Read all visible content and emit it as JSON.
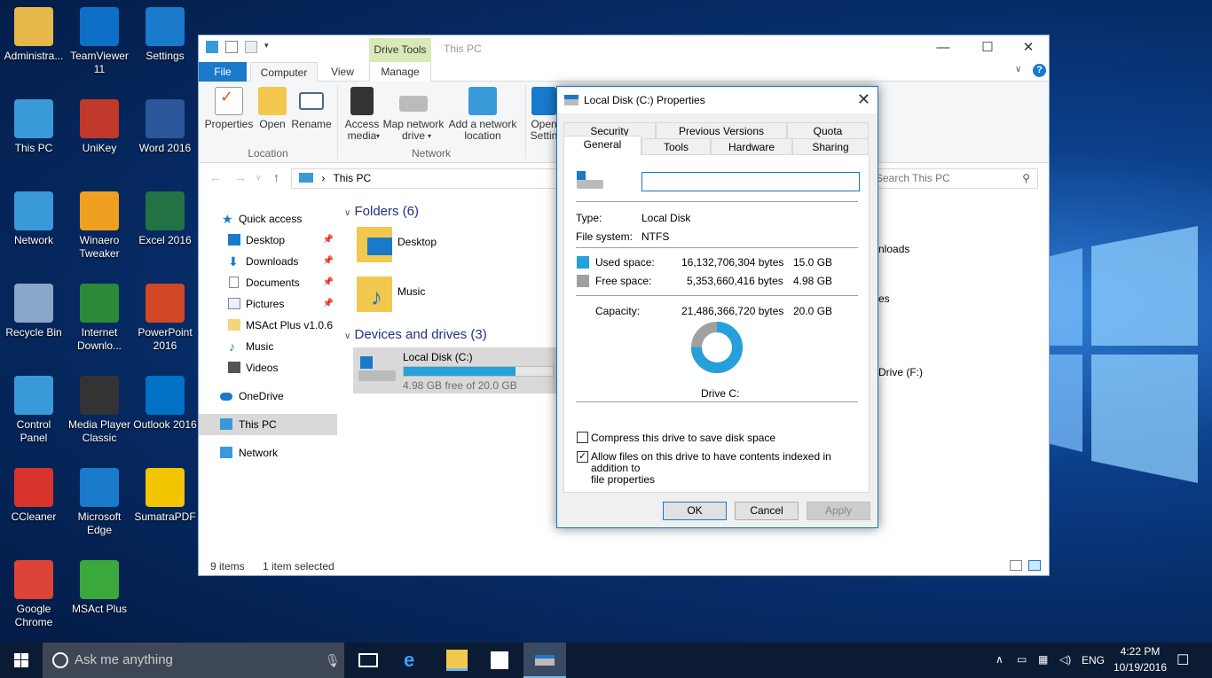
{
  "desktop": {
    "icons": [
      {
        "label": "Administra...",
        "icon": "user-folder-icon",
        "color": "#e6b84a"
      },
      {
        "label": "TeamViewer\n11",
        "icon": "teamviewer-icon",
        "color": "#0e6fc7"
      },
      {
        "label": "Settings",
        "icon": "gear-icon",
        "color": "#1979ca"
      },
      {
        "label": "This PC",
        "icon": "computer-icon",
        "color": "#3a9ad9"
      },
      {
        "label": "UniKey",
        "icon": "unikey-icon",
        "color": "#c0392b"
      },
      {
        "label": "Word 2016",
        "icon": "word-icon",
        "color": "#2b579a"
      },
      {
        "label": "Network",
        "icon": "network-icon",
        "color": "#3a9ad9"
      },
      {
        "label": "Winaero\nTweaker",
        "icon": "winaero-icon",
        "color": "#f0a020"
      },
      {
        "label": "Excel 2016",
        "icon": "excel-icon",
        "color": "#217346"
      },
      {
        "label": "Recycle Bin",
        "icon": "recycle-bin-icon",
        "color": "#8aa6c8"
      },
      {
        "label": "Internet\nDownlo...",
        "icon": "idm-icon",
        "color": "#2a8a3a"
      },
      {
        "label": "PowerPoint\n2016",
        "icon": "powerpoint-icon",
        "color": "#d24726"
      },
      {
        "label": "Control\nPanel",
        "icon": "control-panel-icon",
        "color": "#3a9ad9"
      },
      {
        "label": "Media Player\nClassic",
        "icon": "media-player-icon",
        "color": "#333"
      },
      {
        "label": "Outlook 2016",
        "icon": "outlook-icon",
        "color": "#0072c6"
      },
      {
        "label": "CCleaner",
        "icon": "ccleaner-icon",
        "color": "#d9342b"
      },
      {
        "label": "Microsoft\nEdge",
        "icon": "edge-icon",
        "color": "#1979ca"
      },
      {
        "label": "SumatraPDF",
        "icon": "pdf-icon",
        "color": "#f2c500"
      },
      {
        "label": "Google\nChrome",
        "icon": "chrome-icon",
        "color": "#db4437"
      },
      {
        "label": "MSAct Plus",
        "icon": "key-icon",
        "color": "#3aa83a"
      }
    ]
  },
  "explorer": {
    "drive_tools": "Drive Tools",
    "title": "This PC",
    "tabs": {
      "file": "File",
      "computer": "Computer",
      "view": "View",
      "manage": "Manage"
    },
    "ribbon": {
      "properties": "Properties",
      "open": "Open",
      "rename": "Rename",
      "access_media": "Access\nmedia",
      "map_network": "Map network\ndrive",
      "add_network": "Add a network\nlocation",
      "open_settings": "Open\nSettin",
      "group_location": "Location",
      "group_network": "Network"
    },
    "address": "This PC",
    "search_placeholder": "Search This PC",
    "sidebar": {
      "quick_access": "Quick access",
      "desktop": "Desktop",
      "downloads": "Downloads",
      "documents": "Documents",
      "pictures": "Pictures",
      "msact": "MSAct Plus v1.0.6",
      "music": "Music",
      "videos": "Videos",
      "onedrive": "OneDrive",
      "thispc": "This PC",
      "network": "Network"
    },
    "folders_header": "Folders (6)",
    "folders": {
      "desktop": "Desktop",
      "music": "Music",
      "downloads_partial": "nloads",
      "pictures_partial": "es"
    },
    "devices_header": "Devices and drives (3)",
    "drive_c": {
      "name": "Local Disk (C:)",
      "free": "4.98 GB free of 20.0 GB",
      "used_fraction": 0.75
    },
    "drive_f_partial": "Drive (F:)",
    "status": {
      "items": "9 items",
      "selected": "1 item selected"
    }
  },
  "dialog": {
    "title": "Local Disk (C:) Properties",
    "tabs_top": {
      "security": "Security",
      "previous": "Previous Versions",
      "quota": "Quota"
    },
    "tabs_bottom": {
      "general": "General",
      "tools": "Tools",
      "hardware": "Hardware",
      "sharing": "Sharing"
    },
    "name_value": "",
    "type_label": "Type:",
    "type_value": "Local Disk",
    "fs_label": "File system:",
    "fs_value": "NTFS",
    "used_label": "Used space:",
    "used_bytes": "16,132,706,304 bytes",
    "used_gb": "15.0 GB",
    "free_label": "Free space:",
    "free_bytes": "5,353,660,416 bytes",
    "free_gb": "4.98 GB",
    "capacity_label": "Capacity:",
    "capacity_bytes": "21,486,366,720 bytes",
    "capacity_gb": "20.0 GB",
    "used_color": "#26a0da",
    "free_color": "#a0a0a0",
    "drive_label": "Drive C:",
    "compress": "Compress this drive to save disk space",
    "index": "Allow files on this drive to have contents indexed in addition to\nfile properties",
    "ok": "OK",
    "cancel": "Cancel",
    "apply": "Apply"
  },
  "taskbar": {
    "search": "Ask me anything",
    "lang": "ENG",
    "time": "4:22 PM",
    "date": "10/19/2016"
  }
}
